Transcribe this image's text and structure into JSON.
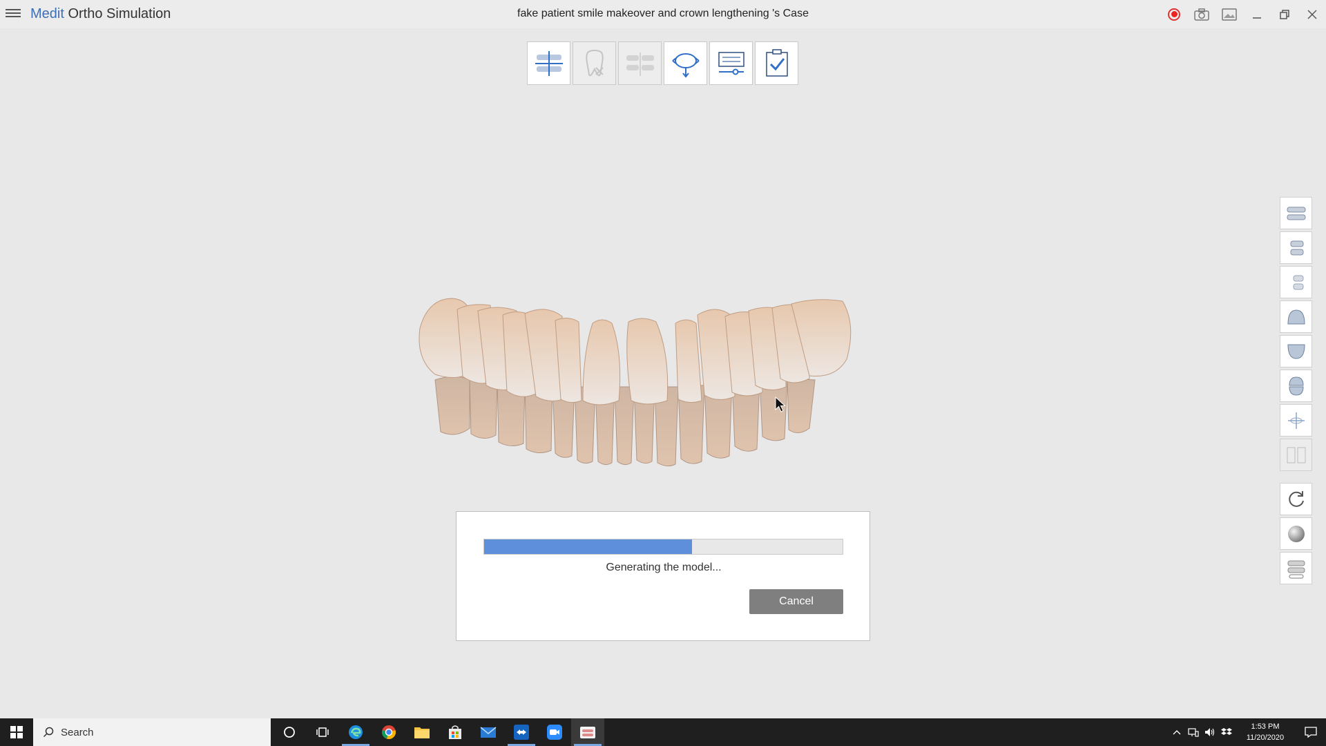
{
  "app": {
    "brand": "Medit",
    "product": " Ortho Simulation",
    "case_title": "fake patient smile makeover and crown lengthening 's Case"
  },
  "title_actions": [
    "record-icon",
    "camera-icon",
    "image-icon",
    "minimize-icon",
    "restore-icon",
    "close-icon"
  ],
  "toolstrip": [
    {
      "icon": "align-arch-icon",
      "enabled": true
    },
    {
      "icon": "tooth-remove-icon",
      "enabled": false
    },
    {
      "icon": "segment-teeth-icon",
      "enabled": false
    },
    {
      "icon": "move-tooth-icon",
      "enabled": true
    },
    {
      "icon": "settings-slider-icon",
      "enabled": true
    },
    {
      "icon": "checklist-icon",
      "enabled": true
    }
  ],
  "dialog": {
    "progress": 0.58,
    "status": "Generating the model...",
    "cancel_label": "Cancel"
  },
  "colors": {
    "accent": "#3c6fb6",
    "progress": "#5d8fdb",
    "record": "#e22222",
    "taskbar": "#1f1f1f"
  },
  "taskbar": {
    "search_placeholder": "Search",
    "apps": [
      "cortana-icon",
      "task-view-icon",
      "edge-icon",
      "chrome-icon",
      "file-explorer-icon",
      "store-icon",
      "mail-icon",
      "teamviewer-icon",
      "zoom-icon",
      "medit-app-icon"
    ],
    "time": "1:53 PM",
    "date": "11/20/2020"
  }
}
